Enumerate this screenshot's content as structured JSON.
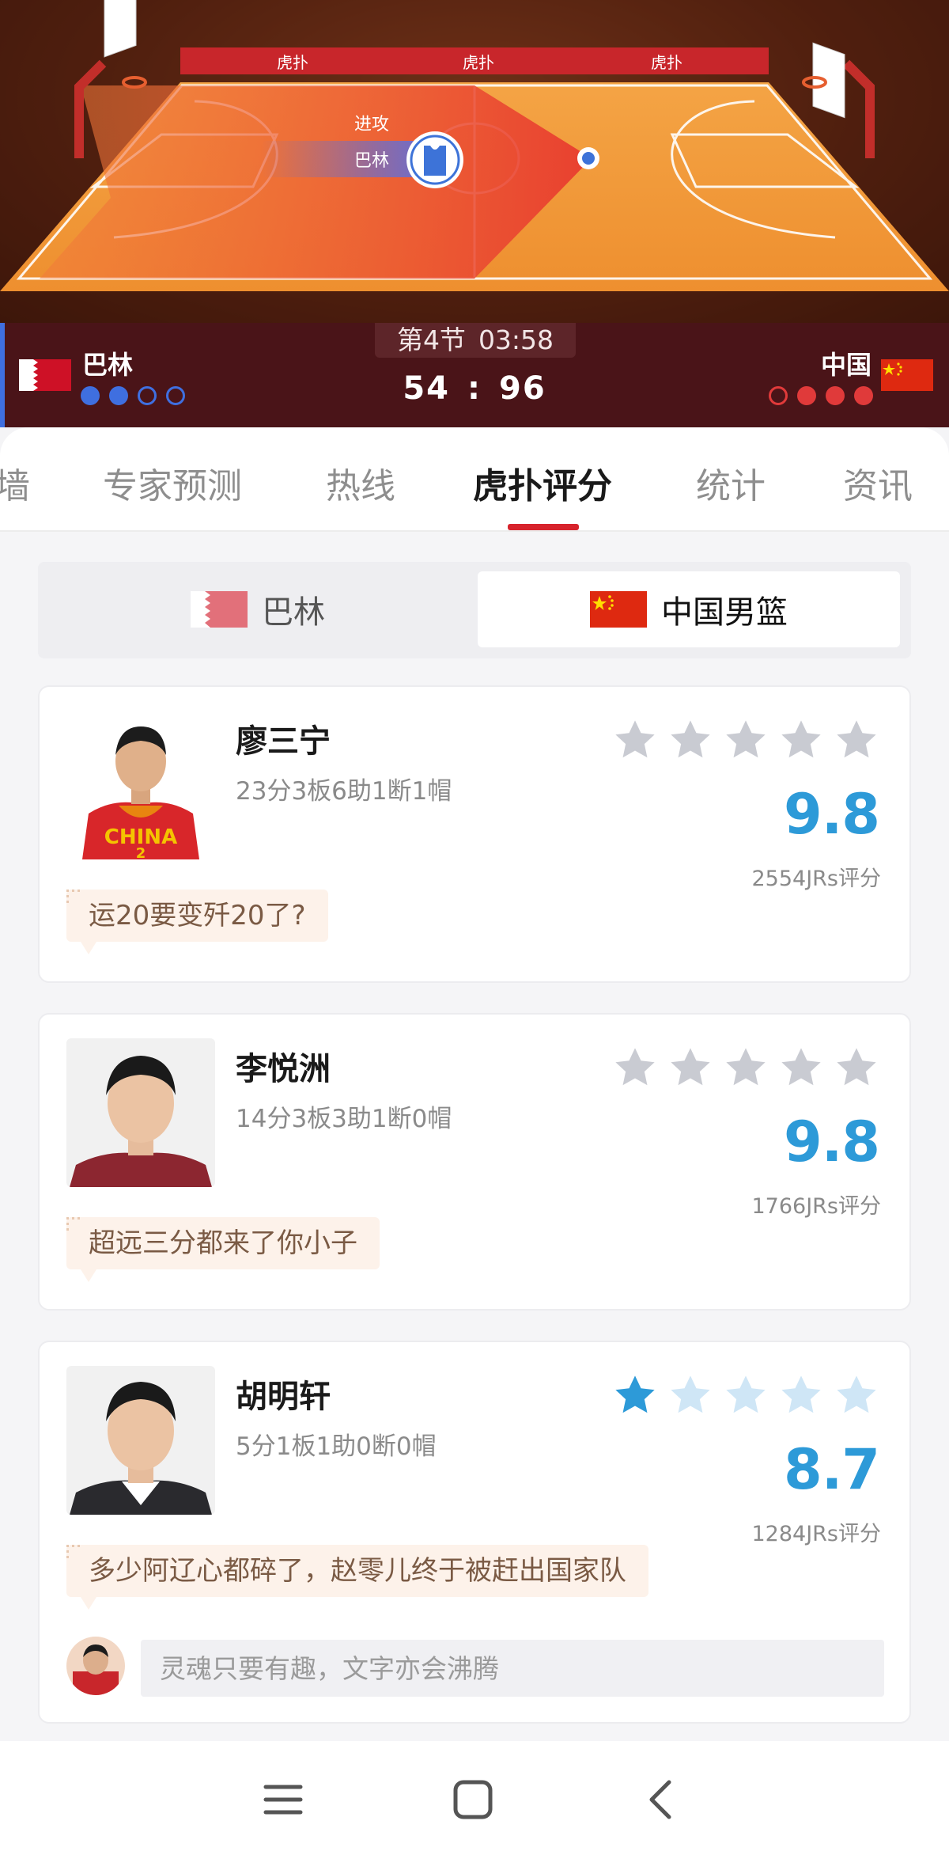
{
  "court": {
    "possession_label": "进攻",
    "possession_team": "巴林",
    "banner_logos": [
      "虎扑",
      "虎扑",
      "虎扑"
    ]
  },
  "scoreboard": {
    "period": "第4节",
    "clock": "03:58",
    "home": {
      "name": "巴林",
      "score": "54"
    },
    "away": {
      "name": "中国",
      "score": "96"
    },
    "separator": ":"
  },
  "tabs": [
    "墙",
    "专家预测",
    "热线",
    "虎扑评分",
    "统计",
    "资讯"
  ],
  "active_tab": "虎扑评分",
  "team_switch": {
    "left": "巴林",
    "right": "中国男篮",
    "selected": "中国男篮"
  },
  "players": [
    {
      "name": "廖三宁",
      "stats": "23分3板6助1断1帽",
      "rating": "9.8",
      "votes": "2554JRs评分",
      "comment": "运20要变歼20了?",
      "filled_stars": 0,
      "jersey_text": "CHINA",
      "jersey_number": "2"
    },
    {
      "name": "李悦洲",
      "stats": "14分3板3助1断0帽",
      "rating": "9.8",
      "votes": "1766JRs评分",
      "comment": "超远三分都来了你小子",
      "filled_stars": 0
    },
    {
      "name": "胡明轩",
      "stats": "5分1板1助0断0帽",
      "rating": "8.7",
      "votes": "1284JRs评分",
      "comment": "多少阿辽心都碎了，赵零儿终于被赶出国家队",
      "filled_stars": 1
    }
  ],
  "reply": {
    "placeholder": "灵魂只要有趣，文字亦会沸腾"
  },
  "colors": {
    "accent_red": "#d7232c",
    "rating_blue": "#2d9ad8",
    "scorebar": "#4a1418",
    "home_dot": "#3f6fe0",
    "away_dot": "#e03a3a"
  },
  "icons": {
    "nav_menu": "menu-icon",
    "nav_home": "home-square-icon",
    "nav_back": "back-chevron-icon",
    "jersey": "jersey-icon"
  }
}
